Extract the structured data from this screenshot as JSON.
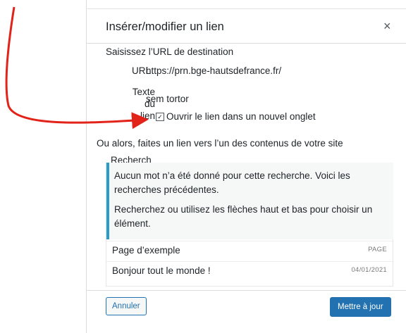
{
  "dialog": {
    "title": "Insérer/modifier un lien",
    "close_symbol": "×",
    "instructions": "Saisissez l’URL de destination",
    "url_label": "URL",
    "url_value": "https://prn.bge-hautsdefrance.fr/",
    "text_label_line1": "Texte du",
    "text_label_line2": "lien",
    "text_value": "sem tortor",
    "checkbox_label": "Ouvrir le lien dans un nouvel onglet",
    "checkbox_checked": true,
    "or_text": "Ou alors, faites un lien vers l’un des contenus de votre site",
    "search_label": "Recherch",
    "notice_p1": "Aucun mot n’a été donné pour cette recherche. Voici les recherches précédentes.",
    "notice_p2": "Recherchez ou utilisez les flèches haut et bas pour choisir un élément.",
    "results": [
      {
        "title": "Page d’exemple",
        "meta": "PAGE"
      },
      {
        "title": "Bonjour tout le monde !",
        "meta": "04/01/2021"
      }
    ],
    "cancel_label": "Annuler",
    "update_label": "Mettre à jour"
  },
  "colors": {
    "accent": "#2271b1",
    "notice_border": "#2a9cc8",
    "annotation_arrow": "#e2231a"
  },
  "icons": {
    "close": "close-icon",
    "checkbox": "checkbox-checked-icon",
    "arrow": "red-arrow-annotation"
  }
}
